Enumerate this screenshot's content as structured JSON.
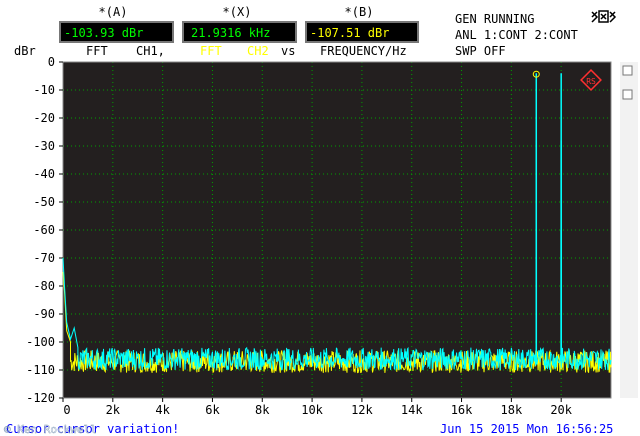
{
  "readouts": [
    {
      "label": "*(A)",
      "value": "-103.93 dBr",
      "value_color": "#00ff00"
    },
    {
      "label": "*(X)",
      "value": "21.9316 kHz",
      "value_color": "#00ff00"
    },
    {
      "label": "*(B)",
      "value": "-107.51 dBr",
      "value_color": "#ffff00"
    }
  ],
  "trace_info": {
    "a_mode": "FFT",
    "a_channel": "CH1,",
    "b_mode": "FFT",
    "b_channel": "CH2",
    "vs": "vs",
    "x_quantity": "FREQUENCY/Hz"
  },
  "status": {
    "line1": "GEN RUNNING",
    "line2": "ANL 1:CONT 2:CONT",
    "line3": "SWP OFF"
  },
  "yaxis_unit": "dBr",
  "icons": {
    "top_right": "printer-network-icon",
    "plot_marker": "rs-logo-icon"
  },
  "bottom_bar": {
    "watermark": "© Ken Rockwell",
    "message": "Cursor cursor variation!",
    "datetime": "Jun 15 2015 Mon 16:56:25"
  },
  "colors": {
    "plot_bg": "#231f1f",
    "grid": "#00a000",
    "trace_a": "#00ffff",
    "trace_b": "#ffff00",
    "text_blue": "#0000ff"
  },
  "chart_data": {
    "type": "line",
    "xlabel": "FREQUENCY/Hz",
    "ylabel": "dBr",
    "xlim": [
      0,
      22000
    ],
    "ylim": [
      -120,
      0
    ],
    "x_ticks": [
      0,
      2000,
      4000,
      6000,
      8000,
      10000,
      12000,
      14000,
      16000,
      18000,
      20000
    ],
    "x_tick_labels": [
      "0",
      "2k",
      "4k",
      "6k",
      "8k",
      "10k",
      "12k",
      "14k",
      "16k",
      "18k",
      "20k"
    ],
    "y_ticks": [
      0,
      -10,
      -20,
      -30,
      -40,
      -50,
      -60,
      -70,
      -80,
      -90,
      -100,
      -110,
      -120
    ],
    "y_tick_labels": [
      "0",
      "-10",
      "-20",
      "-30",
      "-40",
      "-50",
      "-60",
      "-70",
      "-80",
      "-90",
      "-100",
      "-110",
      "-120"
    ],
    "grid": true,
    "series": [
      {
        "color": "#00ffff",
        "noise_floor": -106,
        "noise_spread": 4,
        "points": [
          [
            0,
            -70
          ],
          [
            60,
            -80
          ],
          [
            150,
            -93
          ],
          [
            300,
            -99
          ],
          [
            450,
            -95
          ],
          [
            600,
            -102
          ]
        ],
        "peaks": [
          [
            19000,
            -4
          ],
          [
            19000,
            -28
          ],
          [
            19000,
            -60
          ],
          [
            20000,
            -4
          ],
          [
            20000,
            -28
          ],
          [
            20000,
            -60
          ]
        ]
      },
      {
        "color": "#ffff00",
        "noise_floor": -107,
        "noise_spread": 4,
        "points": [
          [
            0,
            -75
          ],
          [
            60,
            -82
          ],
          [
            150,
            -96
          ],
          [
            300,
            -100
          ]
        ],
        "peaks": []
      }
    ]
  }
}
